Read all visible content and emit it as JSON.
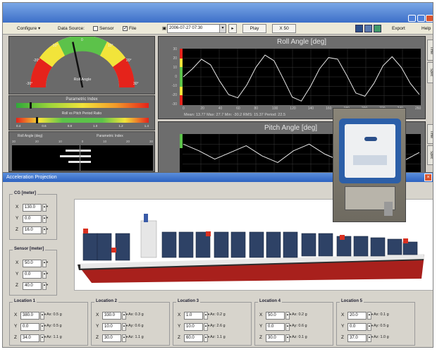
{
  "toolbar": {
    "configure_label": "Configure",
    "data_source_label": "Data Source:",
    "sensor_label": "Sensor",
    "file_label": "File",
    "date_value": "2006-07-27 07:30",
    "play_label": "Play",
    "rate_label": "X 50",
    "export_label": "Export",
    "help_label": "Help"
  },
  "gauge": {
    "label": "Roll Angle",
    "ticks": [
      "-30°",
      "-20°",
      "-10°",
      "0",
      "10°",
      "20°",
      "30°"
    ],
    "value_deg": -5
  },
  "index_bars": {
    "bar1_title": "Parametric Index",
    "bar1_value": 0.1,
    "bar2_title": "Roll vs Pitch Period Ratio",
    "bar2_ticks": [
      "0.4",
      "0.6",
      "0.8",
      "1.0",
      "1.2",
      "1.4"
    ],
    "bar2_value": 0.55
  },
  "mini_panel": {
    "left_title": "Roll Angle (deg)",
    "right_title": "Parametric Index",
    "scale": [
      "30",
      "20",
      "10",
      "0",
      "10",
      "20",
      "30"
    ]
  },
  "roll_chart": {
    "title": "Roll Angle [deg]",
    "yticks": [
      "30",
      "20",
      "10",
      "0",
      "-10",
      "-20",
      "-30"
    ],
    "xticks": [
      "0",
      "20",
      "40",
      "60",
      "80",
      "100",
      "120",
      "140",
      "160",
      "180",
      "200",
      "220",
      "240",
      "260"
    ],
    "stats": "Mean: 13.77   Max: 27.7   Min: -30.2   RMS: 15.37   Period: 22.5",
    "values": [
      0,
      10,
      22,
      15,
      -5,
      -22,
      -26,
      -10,
      12,
      27,
      20,
      -2,
      -25,
      -30,
      -12,
      10,
      24,
      22,
      2,
      -20,
      -24,
      -8,
      14,
      25,
      12,
      -8,
      -22
    ]
  },
  "pitch_chart": {
    "title": "Pitch Angle [deg]",
    "values": [
      6,
      2,
      -3,
      1,
      5,
      -1,
      -5,
      2,
      6,
      0,
      -4,
      3,
      5,
      -2,
      -4,
      1
    ]
  },
  "side_tabs": [
    "Time",
    "Spec",
    "Time",
    "Spec"
  ],
  "dialog": {
    "title": "Acceleration Projection",
    "cg": {
      "label": "CG [meter]",
      "x": "130.0",
      "y": "0.0",
      "z": "16.0"
    },
    "sensor": {
      "label": "Sensor [meter]",
      "x": "50.0",
      "y": "0.0",
      "z": "40.0"
    },
    "locations": [
      {
        "label": "Location 1",
        "x": "380.0",
        "y": "0.0",
        "z": "34.0",
        "ax": "Ax: 0.5 g",
        "ay": "Ay: 0.5 g",
        "az": "Az: 1.1 g"
      },
      {
        "label": "Location 2",
        "x": "330.0",
        "y": "10.0",
        "z": "30.0",
        "ax": "Ax: 0.3 g",
        "ay": "Ay: 0.6 g",
        "az": "Az: 1.1 g"
      },
      {
        "label": "Location 3",
        "x": "1.0",
        "y": "10.0",
        "z": "60.0",
        "ax": "Ax: 0.2 g",
        "ay": "Ay: 2.6 g",
        "az": "Az: 1.1 g"
      },
      {
        "label": "Location 4",
        "x": "50.0",
        "y": "0.0",
        "z": "30.0",
        "ax": "Ax: 0.2 g",
        "ay": "Ay: 0.6 g",
        "az": "Az: 0.1 g"
      },
      {
        "label": "Location 5",
        "x": "20.0",
        "y": "0.0",
        "z": "37.0",
        "ax": "Ax: 0.1 g",
        "ay": "Ay: 0.5 g",
        "az": "Az: 1.0 g"
      }
    ]
  },
  "colors": {
    "title_bar": "#3d6fc8",
    "panel": "#6a6a6a",
    "trace": "#e8e8e8",
    "hull": "#a8201c",
    "container": "#2e4266",
    "marker": "#d83020"
  }
}
